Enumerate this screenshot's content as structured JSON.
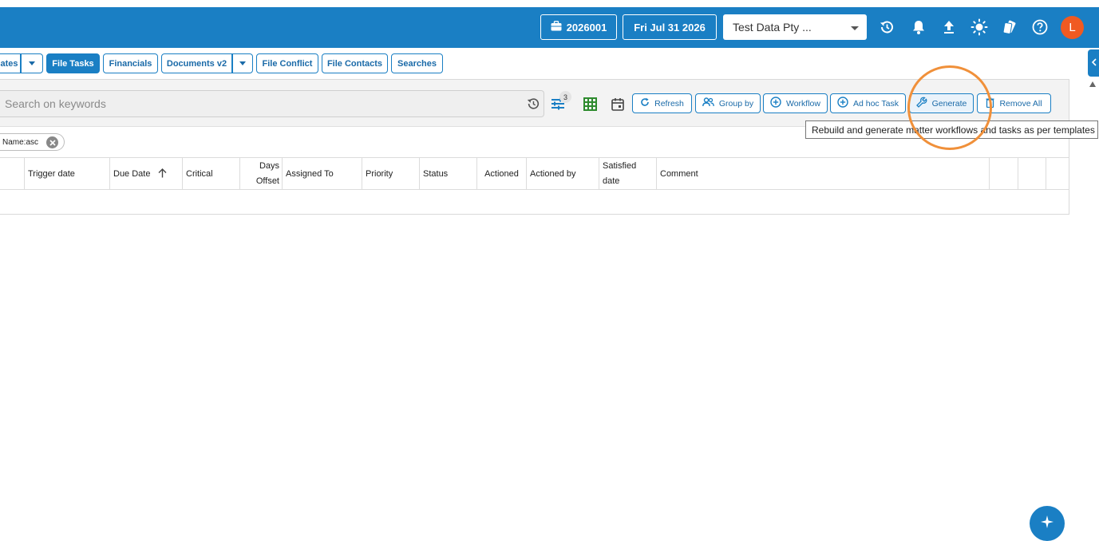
{
  "header": {
    "matter_number": "2026001",
    "date": "Fri Jul 31 2026",
    "company_select": "Test Data Pty ...",
    "avatar_initial": "L"
  },
  "tabs": [
    {
      "label": "ates",
      "active": false,
      "has_dropdown": true
    },
    {
      "label": "File Tasks",
      "active": true,
      "has_dropdown": false
    },
    {
      "label": "Financials",
      "active": false,
      "has_dropdown": false
    },
    {
      "label": "Documents v2",
      "active": false,
      "has_dropdown": true
    },
    {
      "label": "File Conflict",
      "active": false,
      "has_dropdown": false
    },
    {
      "label": "File Contacts",
      "active": false,
      "has_dropdown": false
    },
    {
      "label": "Searches",
      "active": false,
      "has_dropdown": false
    }
  ],
  "search": {
    "placeholder": "Search on keywords"
  },
  "filter_badge_count": "3",
  "actions": {
    "refresh": "Refresh",
    "group_by": "Group by",
    "workflow": "Workflow",
    "ad_hoc_task": "Ad hoc Task",
    "generate": "Generate",
    "remove_all": "Remove All"
  },
  "sort_chip": "Name:asc",
  "tooltip": "Rebuild and generate matter workflows and tasks as per templates",
  "table": {
    "columns": {
      "trigger_date": "Trigger date",
      "due_date": "Due Date",
      "critical": "Critical",
      "days_offset_1": "Days",
      "days_offset_2": "Offset",
      "assigned_to": "Assigned To",
      "priority": "Priority",
      "status": "Status",
      "actioned": "Actioned",
      "actioned_by": "Actioned by",
      "satisfied_1": "Satisfied",
      "satisfied_2": "date",
      "comment": "Comment"
    }
  },
  "colors": {
    "brand": "#1a7fc4",
    "avatar": "#f05a22",
    "annotation": "#f0903a",
    "grid_icon": "#2e8b2e"
  }
}
